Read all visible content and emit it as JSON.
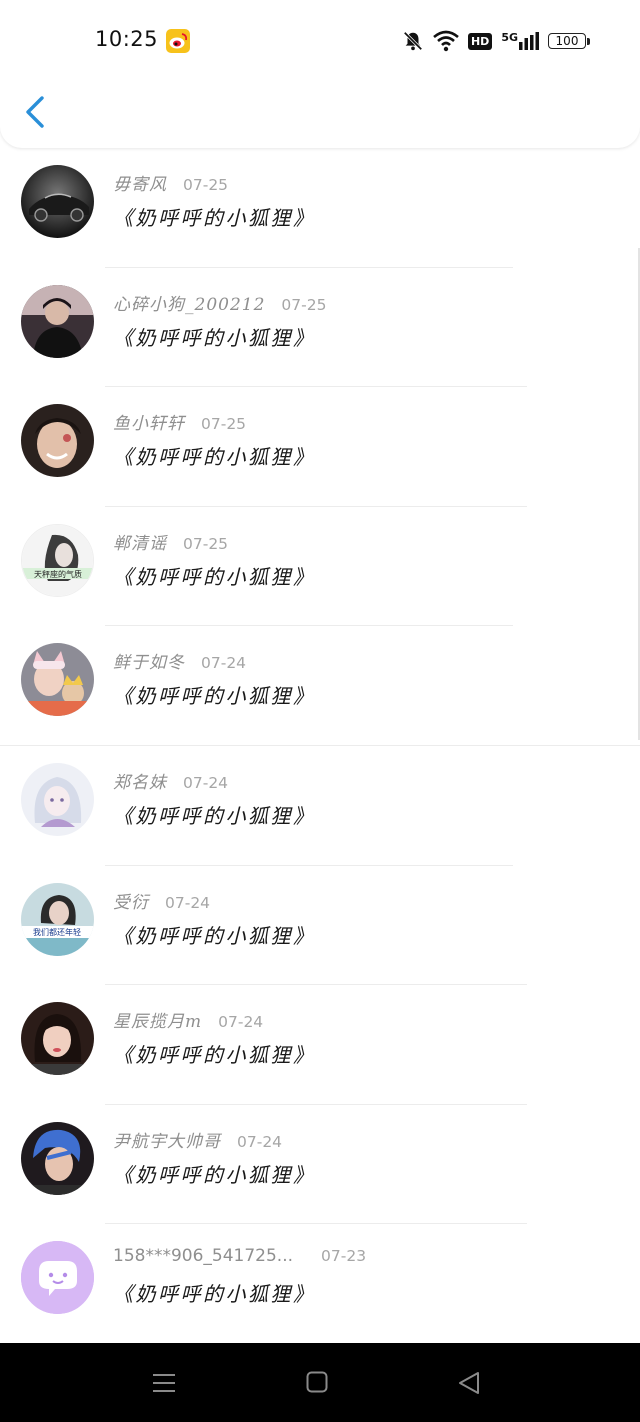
{
  "status_bar": {
    "time": "10:25",
    "app_icon": "weibo-icon",
    "icons": [
      "mute-bell-icon",
      "wifi-icon",
      "hd-badge-icon",
      "5g-signal-icon",
      "battery-icon"
    ],
    "hd_label": "HD",
    "network_label": "5G",
    "battery_level": "100"
  },
  "header": {
    "back_icon": "chevron-left-icon",
    "accent_color": "#2a8fd8"
  },
  "messages": [
    {
      "name": "毋寄风",
      "date": "07-25",
      "title": "《奶呼呼的小狐狸》",
      "avatar": "black-sports-car-photo"
    },
    {
      "name": "心碎小狗_200212",
      "date": "07-25",
      "title": "《奶呼呼的小狐狸》",
      "avatar": "young-man-dark-photo"
    },
    {
      "name": "鱼小轩轩",
      "date": "07-25",
      "title": "《奶呼呼的小狐狸》",
      "avatar": "smiling-boy-photo"
    },
    {
      "name": "郸清谣",
      "date": "07-25",
      "title": "《奶呼呼的小狐狸》",
      "avatar": "girl-sketch-photo",
      "avatar_caption": "天秤座的气质"
    },
    {
      "name": "鲜于如冬",
      "date": "07-24",
      "title": "《奶呼呼的小狐狸》",
      "avatar": "kids-animal-ears-photo"
    },
    {
      "name": "郑名妹",
      "date": "07-24",
      "title": "《奶呼呼的小狐狸》",
      "avatar": "pastel-anime-girl-photo"
    },
    {
      "name": "受衍",
      "date": "07-24",
      "title": "《奶呼呼的小狐狸》",
      "avatar": "teal-portrait-photo",
      "avatar_caption": "我们都还年轻"
    },
    {
      "name": "星辰揽月m",
      "date": "07-24",
      "title": "《奶呼呼的小狐狸》",
      "avatar": "girl-selfie-photo"
    },
    {
      "name": "尹航宇大帅哥",
      "date": "07-24",
      "title": "《奶呼呼的小狐狸》",
      "avatar": "blue-hair-boy-photo"
    },
    {
      "name": "158***906_541725...",
      "date": "07-23",
      "title": "《奶呼呼的小狐狸》",
      "avatar": "default-chat-bubble-avatar"
    }
  ],
  "nav_bar": {
    "items": [
      "menu-icon",
      "home-square-icon",
      "back-triangle-icon"
    ]
  },
  "colors": {
    "name_gray": "#8f8f8f",
    "date_gray": "#a6a6a6",
    "default_avatar_bg": "#d7b8f5"
  }
}
